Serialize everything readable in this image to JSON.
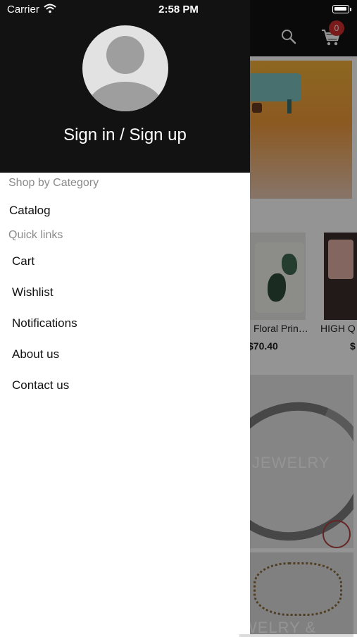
{
  "status_bar": {
    "carrier": "Carrier",
    "time": "2:58 PM"
  },
  "app_bar": {
    "cart_count": "0"
  },
  "drawer": {
    "sign_in_label": "Sign in / Sign up",
    "shop_section_title": "Shop by Category",
    "catalog_label": "Catalog",
    "quick_links_title": "Quick links",
    "quick_links": [
      "Cart",
      "Wishlist",
      "Notifications",
      "About us",
      "Contact us"
    ]
  },
  "background": {
    "products": [
      {
        "name": "Floral Prin…",
        "price": "$70.40"
      },
      {
        "name": "HIGH Q",
        "price": "$"
      }
    ],
    "tiles": [
      "JEWELRY",
      "WELRY &"
    ]
  },
  "colors": {
    "header_bg": "#121212",
    "badge": "#d32f2f",
    "section_text": "#8a8a8a"
  },
  "icons": [
    "search-icon",
    "cart-icon",
    "wifi-icon",
    "battery-icon",
    "avatar-icon"
  ]
}
